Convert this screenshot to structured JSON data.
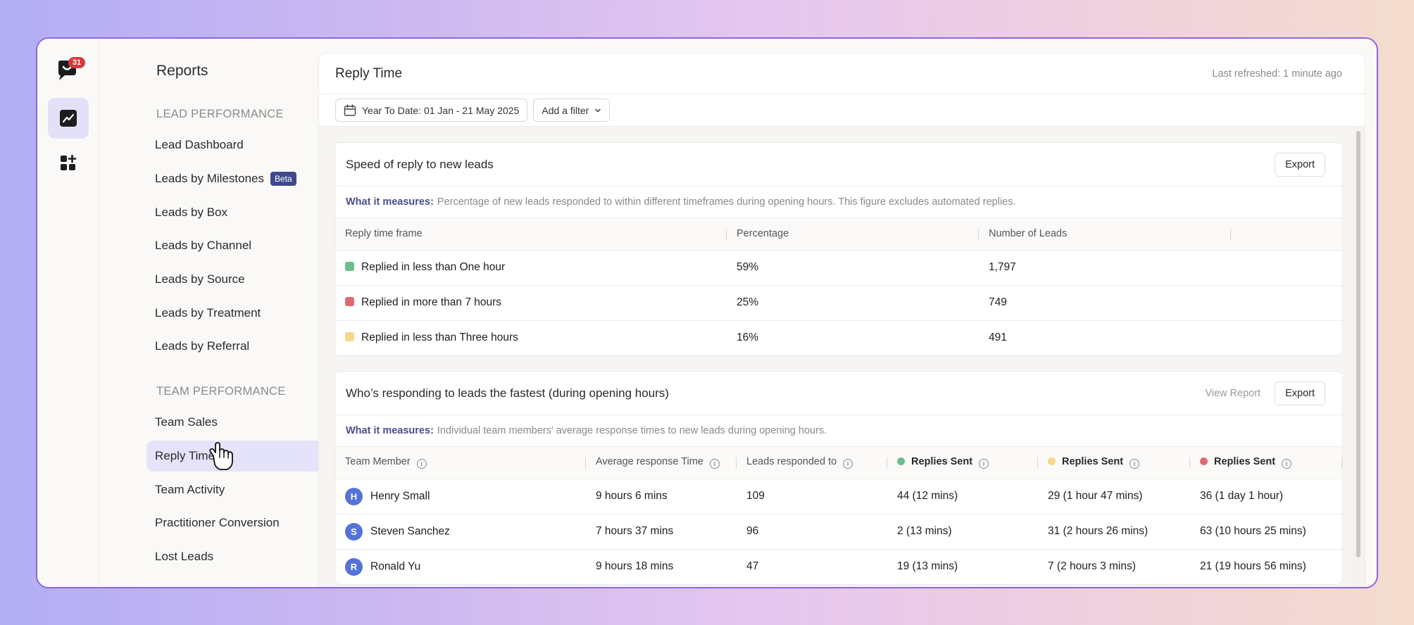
{
  "colors": {
    "green": "#6abf8d",
    "red": "#de6a70",
    "yellow": "#f5d98a",
    "accent": "#4b4d8f",
    "avatar": "#5472d8"
  },
  "app": {
    "notification_count": "31"
  },
  "sidebar": {
    "title": "Reports",
    "sections": [
      {
        "heading": "LEAD PERFORMANCE",
        "items": [
          {
            "label": "Lead Dashboard"
          },
          {
            "label": "Leads by Milestones",
            "badge": "Beta"
          },
          {
            "label": "Leads by Box"
          },
          {
            "label": "Leads by Channel"
          },
          {
            "label": "Leads by Source"
          },
          {
            "label": "Leads by Treatment"
          },
          {
            "label": "Leads by Referral"
          }
        ]
      },
      {
        "heading": "TEAM PERFORMANCE",
        "items": [
          {
            "label": "Team Sales"
          },
          {
            "label": "Reply Time",
            "active": true
          },
          {
            "label": "Team Activity"
          },
          {
            "label": "Practitioner Conversion"
          },
          {
            "label": "Lost Leads"
          }
        ]
      }
    ]
  },
  "header": {
    "title": "Reply Time",
    "refreshed": "Last refreshed: 1 minute ago"
  },
  "filters": {
    "date_range": "Year To Date: 01 Jan - 21 May 2025",
    "add_filter": "Add a filter"
  },
  "speed_card": {
    "title": "Speed of reply to new leads",
    "export": "Export",
    "measures_label": "What it measures:",
    "measures_text": "Percentage of new leads responded to within different timeframes during opening hours. This figure excludes automated replies.",
    "columns": [
      "Reply time frame",
      "Percentage",
      "Number of Leads"
    ],
    "rows": [
      {
        "label": "Replied in less than One hour",
        "pct": "59%",
        "leads": "1,797",
        "color": "green"
      },
      {
        "label": "Replied in more than 7 hours",
        "pct": "25%",
        "leads": "749",
        "color": "red"
      },
      {
        "label": "Replied in less than Three hours",
        "pct": "16%",
        "leads": "491",
        "color": "yellow"
      }
    ]
  },
  "fastest_card": {
    "title": "Who’s responding to leads the fastest (during opening hours)",
    "view_report": "View Report",
    "export": "Export",
    "measures_label": "What it measures:",
    "measures_text": "Individual team members' average response times to new leads during opening hours.",
    "columns": [
      "Team Member",
      "Average response Time",
      "Leads responded to",
      "Replies Sent",
      "Replies Sent",
      "Replies Sent"
    ],
    "rows": [
      {
        "initial": "H",
        "name": "Henry Small",
        "avg": "9 hours 6 mins",
        "leads": "109",
        "green": "44 (12 mins)",
        "yellow": "29 (1 hour 47 mins)",
        "red": "36 (1 day 1 hour)"
      },
      {
        "initial": "S",
        "name": "Steven Sanchez",
        "avg": "7 hours 37 mins",
        "leads": "96",
        "green": "2 (13 mins)",
        "yellow": "31 (2 hours 26 mins)",
        "red": "63 (10 hours 25 mins)"
      },
      {
        "initial": "R",
        "name": "Ronald Yu",
        "avg": "9 hours 18 mins",
        "leads": "47",
        "green": "19 (13 mins)",
        "yellow": "7 (2 hours 3 mins)",
        "red": "21 (19 hours 56 mins)"
      }
    ]
  }
}
